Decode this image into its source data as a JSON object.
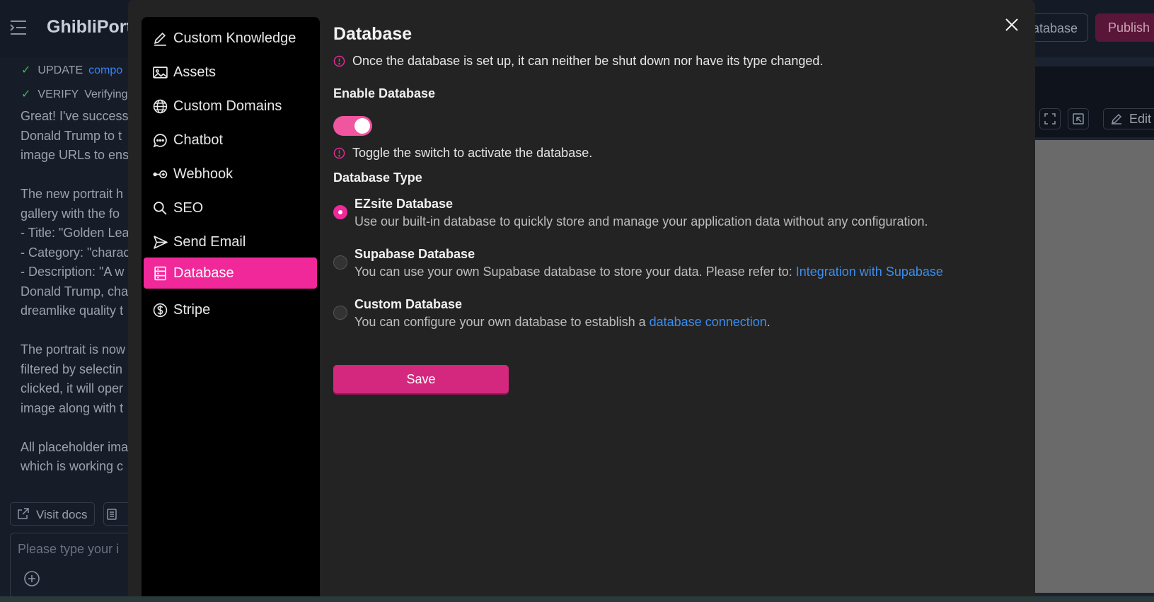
{
  "background": {
    "app_title": "GhibliPort",
    "database_button": "atabase",
    "publish_button": "Publish",
    "chat_steps": [
      {
        "status": "UPDATE",
        "text": "compo"
      },
      {
        "status": "VERIFY",
        "text": "Verifying"
      }
    ],
    "chat_lines": [
      "Great! I've success",
      "Donald Trump to t",
      "image URLs to ens",
      "",
      "The new portrait h",
      "gallery with the fo",
      "- Title: \"Golden Lea",
      "- Category: \"charac",
      "- Description: \"A w",
      "Donald Trump, cha",
      "dreamlike quality t",
      "",
      "The portrait is now",
      "filtered by selectin",
      "clicked, it will oper",
      "image along with t",
      "",
      "All placeholder ima",
      "which is working c"
    ],
    "visit_docs": "Visit docs",
    "input_placeholder": "Please type your i",
    "edit_button": "Edit"
  },
  "modal": {
    "nav": [
      {
        "label": "Custom Knowledge",
        "icon": "pencil-icon"
      },
      {
        "label": "Assets",
        "icon": "image-icon"
      },
      {
        "label": "Custom Domains",
        "icon": "globe-icon"
      },
      {
        "label": "Chatbot",
        "icon": "chat-bubble-icon"
      },
      {
        "label": "Webhook",
        "icon": "webhook-icon"
      },
      {
        "label": "SEO",
        "icon": "search-icon"
      },
      {
        "label": "Send Email",
        "icon": "send-icon"
      },
      {
        "label": "Database",
        "icon": "database-icon",
        "active": true
      },
      {
        "label": "Stripe",
        "icon": "dollar-icon"
      }
    ],
    "title": "Database",
    "warning": "Once the database is set up, it can neither be shut down nor have its type changed.",
    "enable_label": "Enable Database",
    "enable_on": true,
    "toggle_hint": "Toggle the switch to activate the database.",
    "type_label": "Database Type",
    "options": [
      {
        "title": "EZsite Database",
        "desc": "Use our built-in database to quickly store and manage your application data without any configuration.",
        "selected": true
      },
      {
        "title": "Supabase Database",
        "desc": "You can use your own Supabase database to store your data. Please refer to: ",
        "link": "Integration with Supabase",
        "selected": false
      },
      {
        "title": "Custom Database",
        "desc": "You can configure your own database to establish a ",
        "link": "database connection",
        "suffix": ".",
        "selected": false
      }
    ],
    "save_label": "Save"
  },
  "colors": {
    "accent": "#f0289a",
    "toggle": "#f0559f",
    "save": "#d4287e",
    "link": "#3b8ef0"
  }
}
